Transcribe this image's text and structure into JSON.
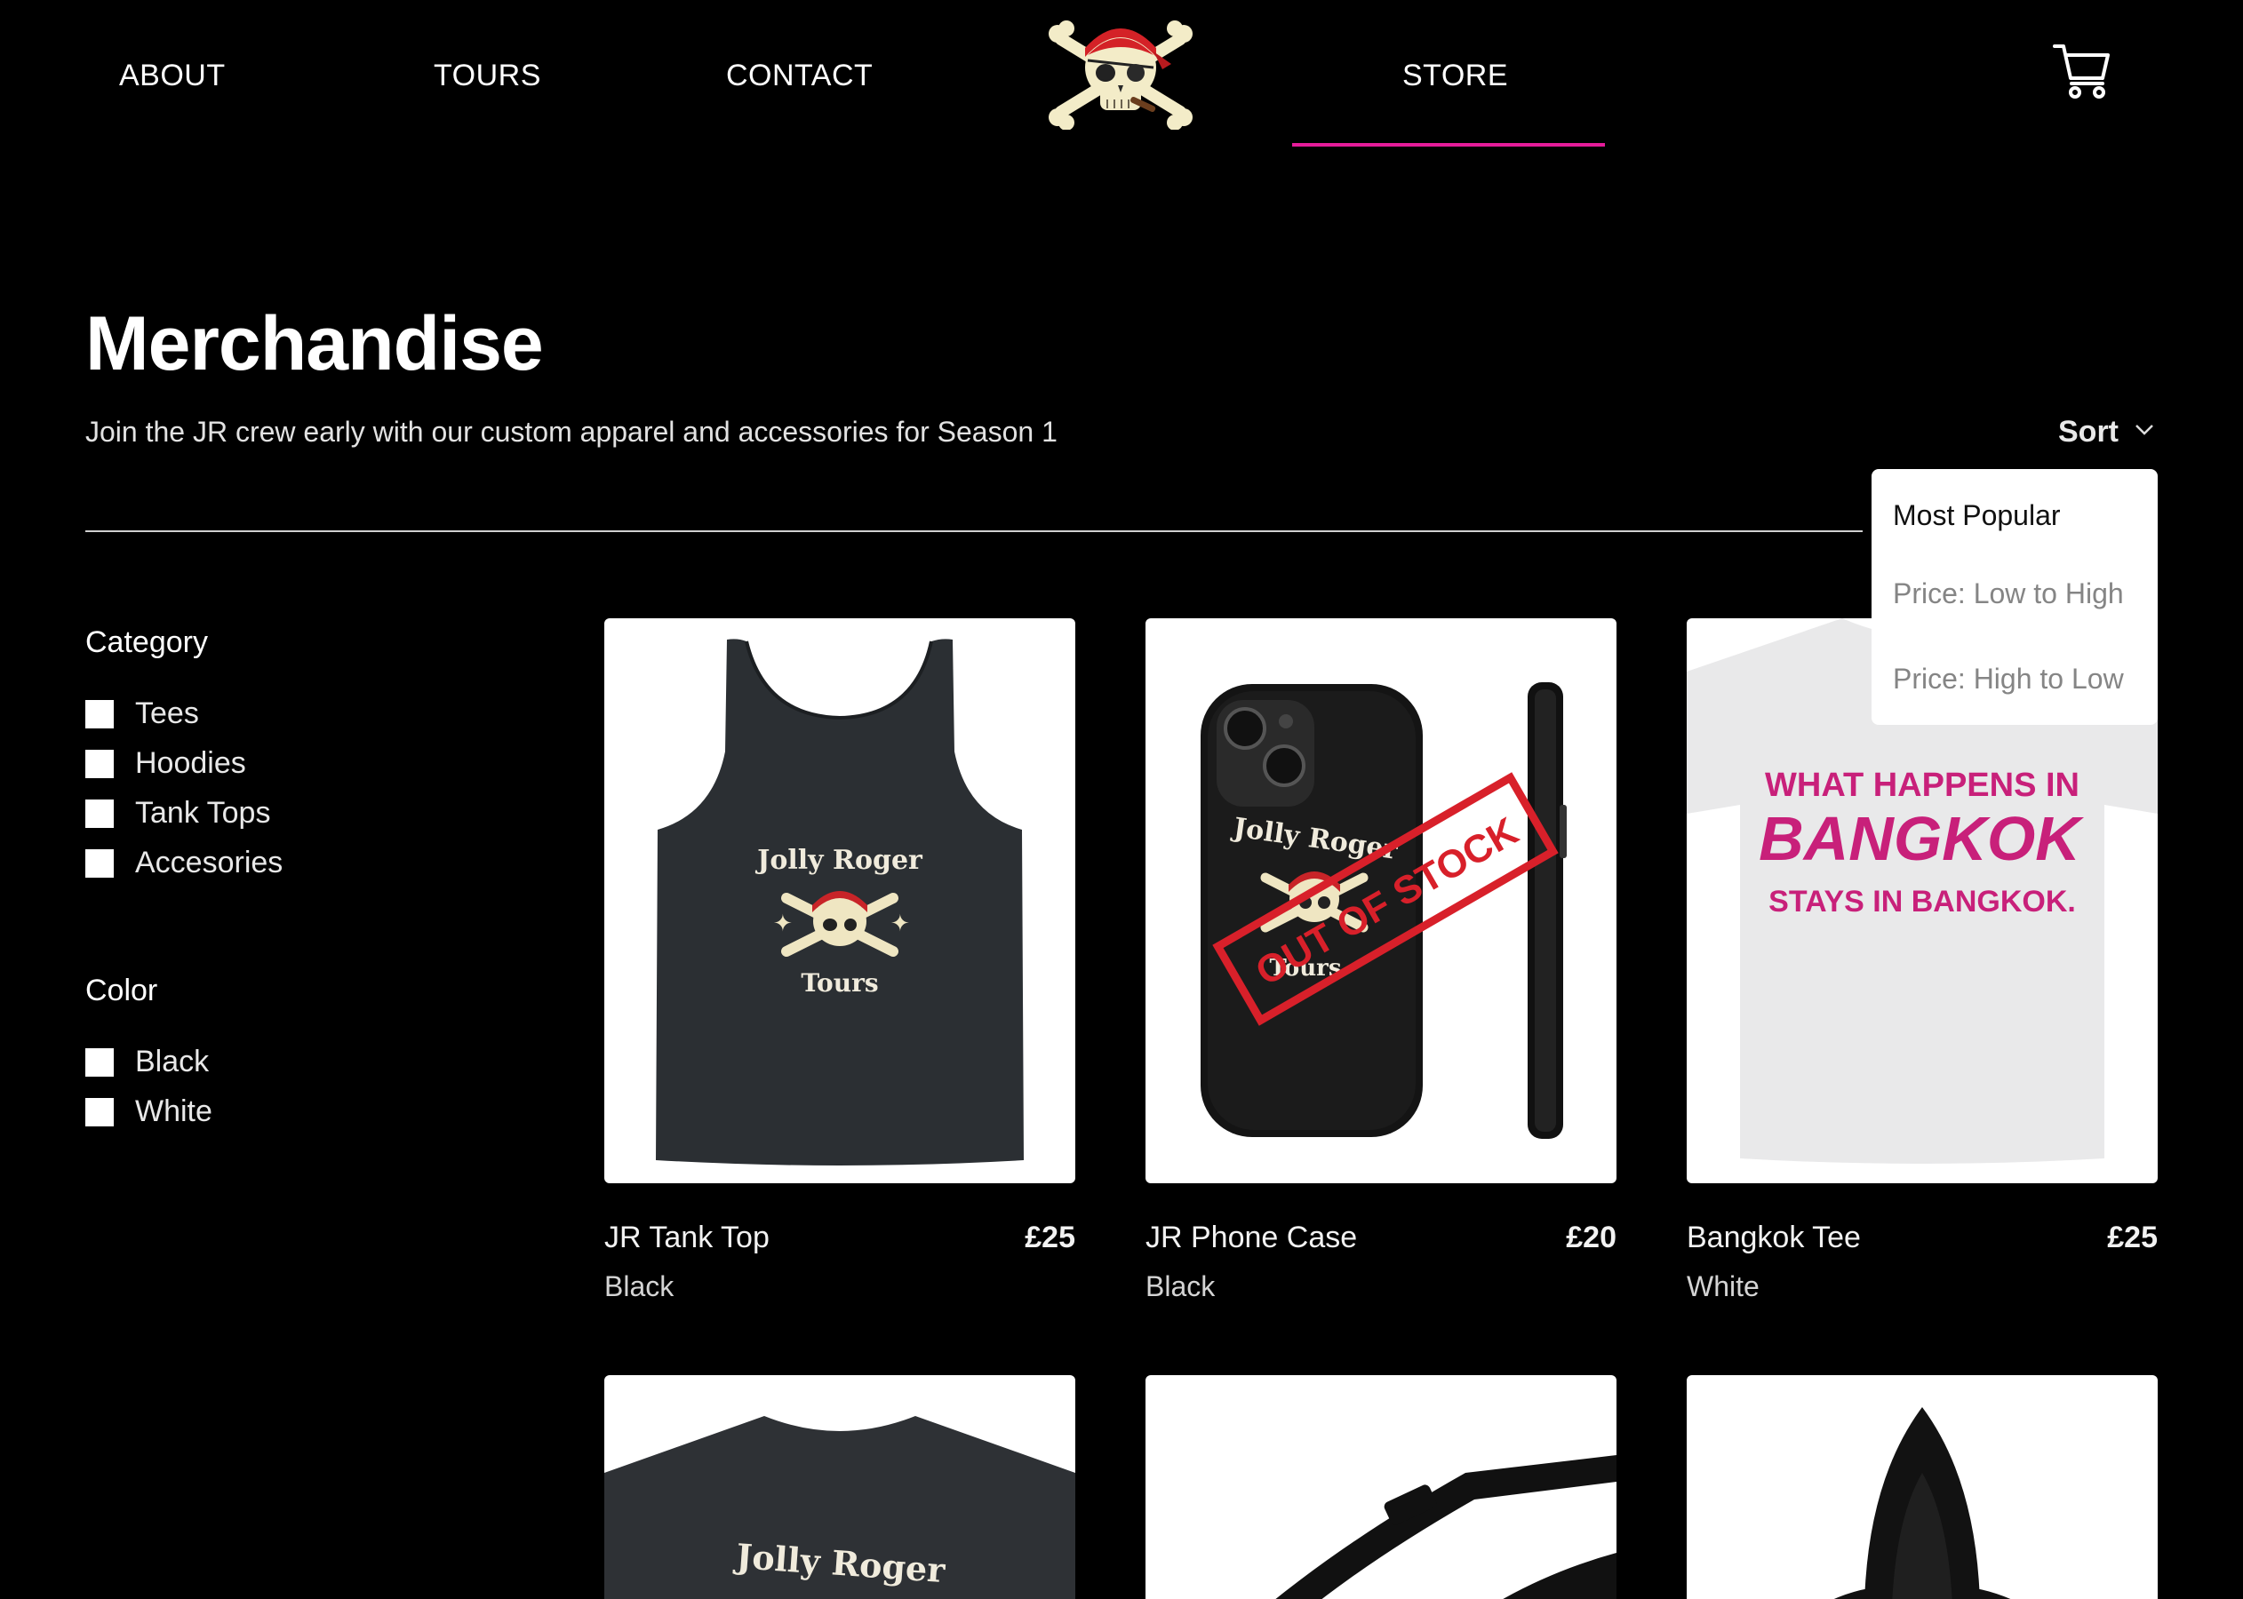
{
  "nav": {
    "about": "ABOUT",
    "tours": "TOURS",
    "contact": "CONTACT",
    "store": "STORE",
    "logo_icon": "jolly-roger-skull-logo",
    "cart_icon": "shopping-cart-icon",
    "active_color": "#e51c9a"
  },
  "header": {
    "title": "Merchandise",
    "subtitle": "Join the JR crew early with our custom apparel and accessories for Season 1",
    "sort_label": "Sort"
  },
  "sort_menu": {
    "options": [
      "Most Popular",
      "Price: Low to High",
      "Price: High to Low"
    ],
    "selected": "Most Popular"
  },
  "filters": {
    "category_heading": "Category",
    "categories": [
      "Tees",
      "Hoodies",
      "Tank Tops",
      "Accesories"
    ],
    "color_heading": "Color",
    "colors": [
      "Black",
      "White"
    ]
  },
  "products": [
    {
      "name": "JR Tank Top",
      "price": "£25",
      "color": "Black",
      "image": "black-tank-top-jolly-roger-print"
    },
    {
      "name": "JR Phone Case",
      "price": "£20",
      "color": "Black",
      "image": "black-phone-case-jolly-roger-print",
      "badge": "OUT OF STOCK"
    },
    {
      "name": "Bangkok Tee",
      "price": "£25",
      "color": "White",
      "image": "white-tee-bangkok-print"
    },
    {
      "name": "",
      "price": "",
      "color": "",
      "image": "black-tee-jolly-roger-print"
    },
    {
      "name": "",
      "price": "",
      "color": "",
      "image": "black-belt-bag"
    },
    {
      "name": "",
      "price": "",
      "color": "",
      "image": "black-hoodie"
    }
  ],
  "print_text": {
    "jolly_roger": "Jolly Roger",
    "tours": "Tours",
    "bangkok_line1": "WHAT HAPPENS IN",
    "bangkok_line2": "BANGKOK",
    "bangkok_line3": "STAYS IN BANGKOK."
  },
  "colors": {
    "badge_red": "#d8202a",
    "bangkok_pink": "#c8207a"
  }
}
